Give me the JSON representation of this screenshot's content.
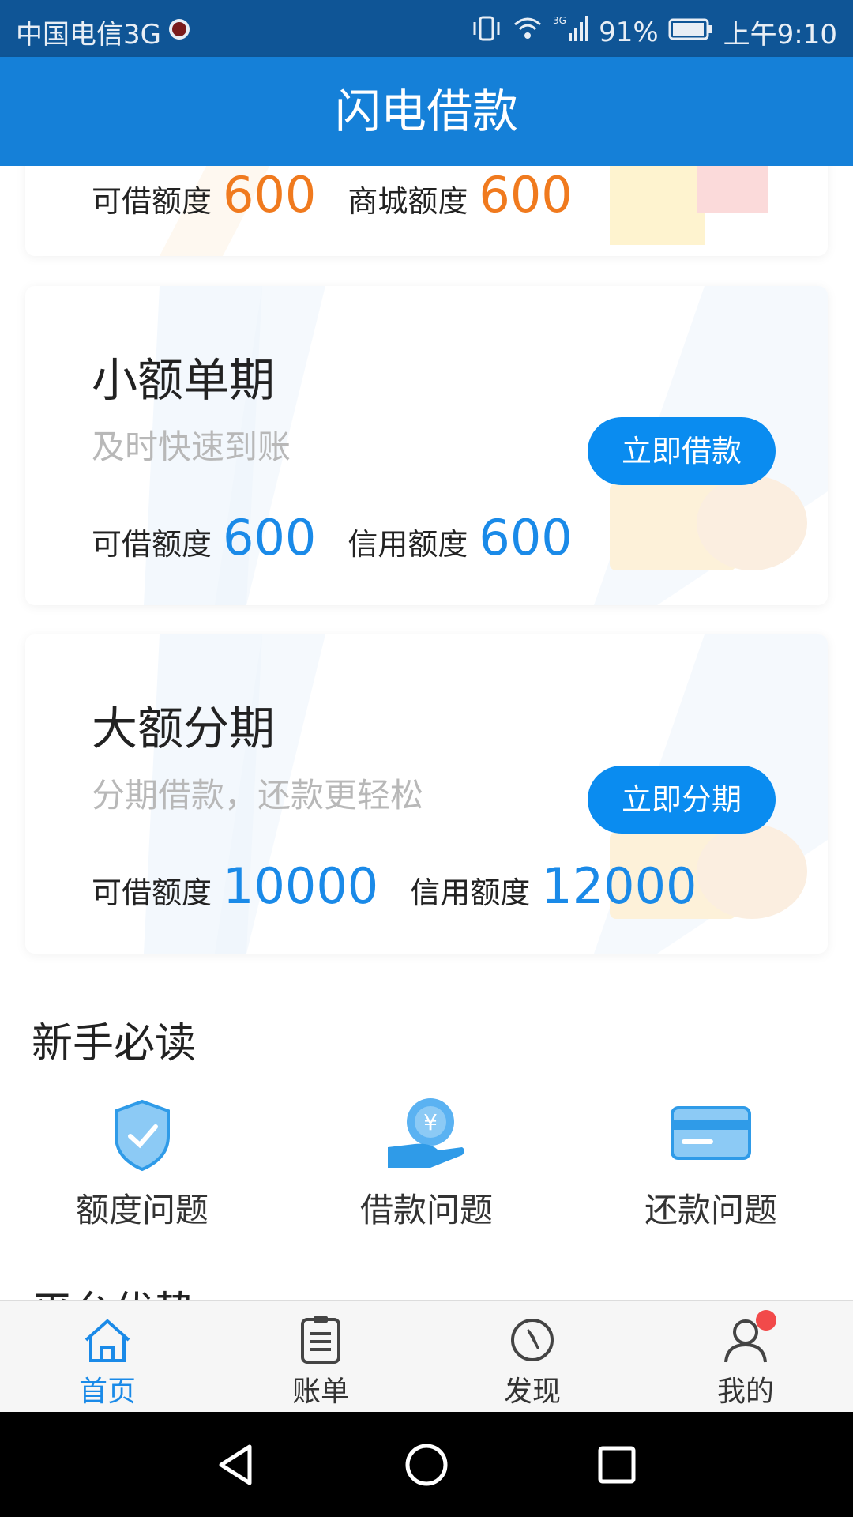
{
  "status_bar": {
    "carrier": "中国电信3G",
    "network": "3G",
    "battery": "91%",
    "time": "上午9:10"
  },
  "app_bar": {
    "title": "闪电借款"
  },
  "top_card": {
    "available_label": "可借额度",
    "available_value": "600",
    "mall_label": "商城额度",
    "mall_value": "600"
  },
  "small_loan_card": {
    "title": "小额单期",
    "subtitle": "及时快速到账",
    "button_label": "立即借款",
    "available_label": "可借额度",
    "available_value": "600",
    "credit_label": "信用额度",
    "credit_value": "600"
  },
  "large_loan_card": {
    "title": "大额分期",
    "subtitle": "分期借款，还款更轻松",
    "button_label": "立即分期",
    "available_label": "可借额度",
    "available_value": "10000",
    "credit_label": "信用额度",
    "credit_value": "12000"
  },
  "newbie_section": {
    "title": "新手必读",
    "items": [
      {
        "label": "额度问题",
        "icon": "shield-check-icon"
      },
      {
        "label": "借款问题",
        "icon": "hand-coin-icon"
      },
      {
        "label": "还款问题",
        "icon": "credit-card-icon"
      }
    ]
  },
  "next_section": {
    "title": "平台优势"
  },
  "tab_bar": {
    "tabs": [
      {
        "label": "首页",
        "icon": "home-icon",
        "active": true
      },
      {
        "label": "账单",
        "icon": "bill-icon",
        "active": false
      },
      {
        "label": "发现",
        "icon": "compass-icon",
        "active": false
      },
      {
        "label": "我的",
        "icon": "user-icon",
        "active": false,
        "badge": true
      }
    ]
  },
  "colors": {
    "status_bar": "#0f5596",
    "app_bar": "#1580d8",
    "accent_blue": "#1a8ae8",
    "accent_orange": "#f07a1e",
    "button": "#0a8cf0",
    "badge": "#f24a4a"
  }
}
